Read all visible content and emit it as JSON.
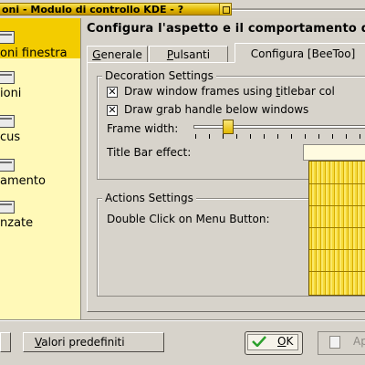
{
  "window": {
    "title": "oni - Modulo di controllo KDE - ? "
  },
  "sidebar": {
    "items": [
      {
        "label": "oni finestra",
        "selected": true
      },
      {
        "label": "ioni",
        "selected": false
      },
      {
        "label": "cus",
        "selected": false
      },
      {
        "label": "amento",
        "selected": false
      },
      {
        "label": "nzate",
        "selected": false
      }
    ]
  },
  "main": {
    "header": "Configura l'aspetto e il comportamento d",
    "tabs": [
      {
        "label": "Generale",
        "underline": "G",
        "rest": "enerale"
      },
      {
        "label": "Pulsanti",
        "underline": "P",
        "rest": "ulsanti"
      },
      {
        "label": "Configura [BeeToo]",
        "underline": "",
        "rest": "Configura [BeeToo]",
        "active": true
      }
    ],
    "decoration": {
      "title": "Decoration Settings",
      "option1": {
        "pre": "Draw window frames using ",
        "ul": "t",
        "post": "itlebar col",
        "checked": true
      },
      "option2": {
        "pre": "Draw ",
        "ul": "g",
        "post": "rab handle below windows",
        "checked": true
      },
      "frame_width_label": "Frame width:",
      "frame_width_value": 0.2,
      "title_bar_effect_label": "Title Bar effect:"
    },
    "actions": {
      "title": "Actions Settings",
      "double_click_label": "Double Click on Menu Button:"
    }
  },
  "buttons": {
    "defaults": {
      "ul": "V",
      "rest": "alori predefiniti"
    },
    "ok": {
      "ul": "O",
      "rest": "K"
    },
    "apply": {
      "label": "Ap"
    }
  },
  "colors": {
    "accent": "#f3cc00",
    "sidebar_bg": "#fff9b8",
    "window_bg": "#d7d3cb"
  }
}
